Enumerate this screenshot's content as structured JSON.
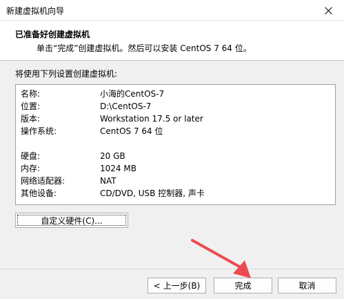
{
  "window": {
    "title": "新建虚拟机向导",
    "close_icon": "close-icon"
  },
  "header": {
    "title": "已准备好创建虚拟机",
    "subtitle": "单击“完成”创建虚拟机。然后可以安装 CentOS 7 64 位。"
  },
  "section_label": "将使用下列设置创建虚拟机:",
  "settings": [
    {
      "key": "名称:",
      "value": "小海的CentOS-7"
    },
    {
      "key": "位置:",
      "value": "D:\\CentOS-7"
    },
    {
      "key": "版本:",
      "value": "Workstation 17.5 or later"
    },
    {
      "key": "操作系统:",
      "value": "CentOS 7 64 位"
    },
    {
      "key": "硬盘:",
      "value": "20 GB"
    },
    {
      "key": "内存:",
      "value": "1024 MB"
    },
    {
      "key": "网络适配器:",
      "value": "NAT"
    },
    {
      "key": "其他设备:",
      "value": "CD/DVD, USB 控制器, 声卡"
    }
  ],
  "buttons": {
    "custom_hardware": "自定义硬件(C)...",
    "back": "< 上一步(B)",
    "finish": "完成",
    "cancel": "取消"
  },
  "colors": {
    "annotation_arrow": "#ee4a52"
  }
}
